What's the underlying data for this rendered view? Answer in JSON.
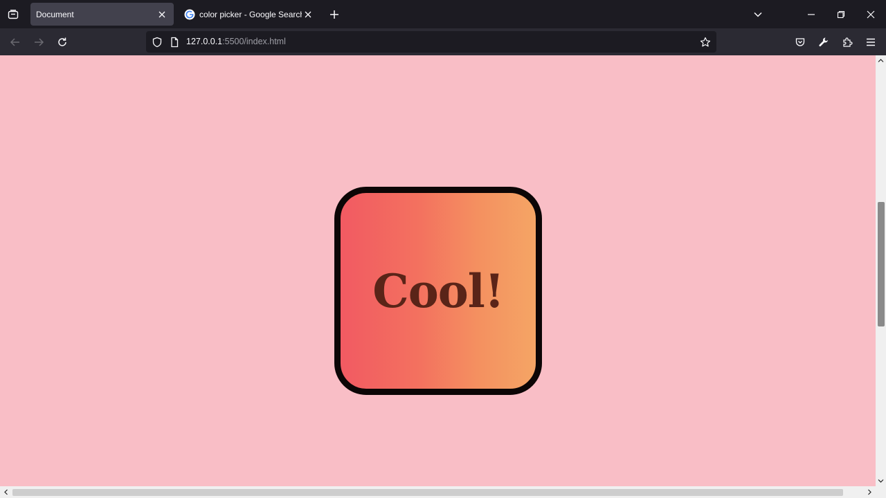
{
  "tabs": [
    {
      "title": "Document",
      "active": true
    },
    {
      "title": "color picker - Google Search",
      "active": false
    }
  ],
  "navbar": {
    "url_host": "127.0.0.1",
    "url_rest": ":5500/index.html"
  },
  "page": {
    "background": "#f9bec6",
    "card_label": "Cool!",
    "card_border": "#0c0606",
    "gradient_colors": [
      "#f25a62",
      "#f5a565"
    ],
    "card_text_color": "#5a2418"
  },
  "icons": {
    "list_all_tabs": "tab-list-icon",
    "close_tab": "close-icon",
    "new_tab": "plus-icon",
    "tab_overflow": "chevron-down-icon",
    "back": "arrow-left-icon",
    "forward": "arrow-right-icon",
    "reload": "reload-icon",
    "tracking_protection": "shield-icon",
    "page_info": "page-icon",
    "bookmark": "star-icon",
    "pocket": "pocket-icon",
    "devtools": "wrench-icon",
    "extensions": "puzzle-icon",
    "menu": "hamburger-icon"
  }
}
